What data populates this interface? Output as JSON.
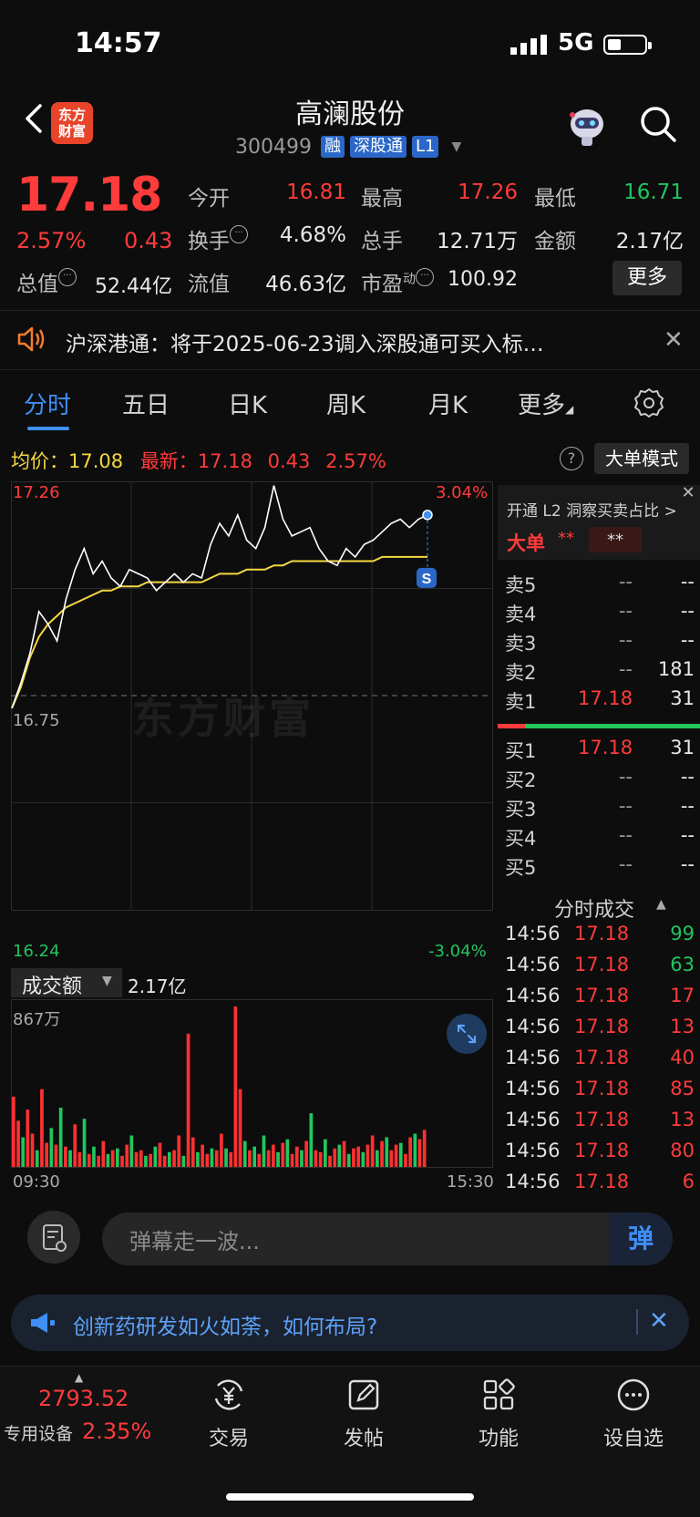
{
  "status": {
    "time": "14:57",
    "network": "5G"
  },
  "header": {
    "logo_line1": "东方",
    "logo_line2": "财富",
    "stock_name": "高澜股份",
    "stock_code": "300499",
    "tags": [
      "融",
      "深股通",
      "L1"
    ]
  },
  "quote": {
    "price": "17.18",
    "change_pct": "2.57%",
    "change_amt": "0.43",
    "market_cap_label": "总值",
    "market_cap": "52.44亿",
    "fields": [
      {
        "label": "今开",
        "value": "16.81",
        "color": "red"
      },
      {
        "label": "最高",
        "value": "17.26",
        "color": "red"
      },
      {
        "label": "最低",
        "value": "16.71",
        "color": "green"
      },
      {
        "label": "换手",
        "value": "4.68%",
        "color": "white"
      },
      {
        "label": "总手",
        "value": "12.71万",
        "color": "white"
      },
      {
        "label": "金额",
        "value": "2.17亿",
        "color": "white"
      },
      {
        "label": "流值",
        "value": "46.63亿",
        "color": "white"
      },
      {
        "label": "市盈",
        "value": "100.92",
        "color": "white",
        "superscript": "动"
      }
    ],
    "more_button": "更多"
  },
  "notice": {
    "text": "沪深港通：将于2025-06-23调入深股通可买入标…"
  },
  "tabs": [
    "分时",
    "五日",
    "日K",
    "周K",
    "月K",
    "更多"
  ],
  "avg_row": {
    "avg_label": "均价：",
    "avg_value": "17.08",
    "latest_label": "最新：",
    "latest_value": "17.18",
    "latest_chg": "0.43",
    "latest_pct": "2.57%",
    "mode_button": "大单模式"
  },
  "chart_data": {
    "type": "line",
    "y_ticks": {
      "high": "17.26",
      "mid": "16.75",
      "low": "16.24",
      "high_pct": "3.04%",
      "low_pct": "-3.04%"
    },
    "ylim": [
      16.24,
      17.26
    ],
    "x_labels": [
      "09:30",
      "15:30"
    ],
    "watermark": "东方财富",
    "series": [
      {
        "name": "price",
        "color": "#ffffff",
        "values": [
          16.72,
          16.78,
          16.85,
          16.95,
          16.92,
          16.88,
          16.98,
          17.05,
          17.1,
          17.04,
          17.07,
          17.03,
          17.01,
          17.05,
          17.04,
          17.03,
          17.0,
          17.02,
          17.04,
          17.02,
          17.04,
          17.03,
          17.11,
          17.16,
          17.13,
          17.18,
          17.12,
          17.1,
          17.15,
          17.25,
          17.17,
          17.13,
          17.14,
          17.15,
          17.1,
          17.07,
          17.06,
          17.1,
          17.08,
          17.11,
          17.12,
          17.14,
          17.16,
          17.17,
          17.15,
          17.17,
          17.18
        ]
      },
      {
        "name": "avg",
        "color": "#f5d742",
        "values": [
          16.72,
          16.77,
          16.84,
          16.89,
          16.92,
          16.94,
          16.96,
          16.97,
          16.98,
          16.99,
          17.0,
          17.0,
          17.01,
          17.01,
          17.01,
          17.02,
          17.02,
          17.02,
          17.02,
          17.02,
          17.02,
          17.02,
          17.03,
          17.04,
          17.04,
          17.04,
          17.05,
          17.05,
          17.05,
          17.06,
          17.06,
          17.07,
          17.07,
          17.07,
          17.07,
          17.07,
          17.07,
          17.07,
          17.07,
          17.07,
          17.07,
          17.08,
          17.08,
          17.08,
          17.08,
          17.08,
          17.08
        ]
      }
    ],
    "volume": {
      "label": "成交额",
      "total": "2.17亿",
      "max_label": "867万",
      "max": 867,
      "bars": [
        {
          "v": 380,
          "c": "r"
        },
        {
          "v": 250,
          "c": "r"
        },
        {
          "v": 160,
          "c": "g"
        },
        {
          "v": 310,
          "c": "r"
        },
        {
          "v": 180,
          "c": "r"
        },
        {
          "v": 90,
          "c": "g"
        },
        {
          "v": 420,
          "c": "r"
        },
        {
          "v": 130,
          "c": "r"
        },
        {
          "v": 210,
          "c": "g"
        },
        {
          "v": 120,
          "c": "r"
        },
        {
          "v": 320,
          "c": "g"
        },
        {
          "v": 110,
          "c": "r"
        },
        {
          "v": 90,
          "c": "g"
        },
        {
          "v": 230,
          "c": "r"
        },
        {
          "v": 80,
          "c": "r"
        },
        {
          "v": 260,
          "c": "g"
        },
        {
          "v": 70,
          "c": "r"
        },
        {
          "v": 110,
          "c": "g"
        },
        {
          "v": 60,
          "c": "r"
        },
        {
          "v": 140,
          "c": "r"
        },
        {
          "v": 70,
          "c": "g"
        },
        {
          "v": 90,
          "c": "r"
        },
        {
          "v": 100,
          "c": "g"
        },
        {
          "v": 60,
          "c": "r"
        },
        {
          "v": 120,
          "c": "r"
        },
        {
          "v": 170,
          "c": "g"
        },
        {
          "v": 80,
          "c": "r"
        },
        {
          "v": 90,
          "c": "r"
        },
        {
          "v": 60,
          "c": "g"
        },
        {
          "v": 70,
          "c": "r"
        },
        {
          "v": 110,
          "c": "g"
        },
        {
          "v": 130,
          "c": "r"
        },
        {
          "v": 60,
          "c": "r"
        },
        {
          "v": 80,
          "c": "g"
        },
        {
          "v": 90,
          "c": "r"
        },
        {
          "v": 170,
          "c": "r"
        },
        {
          "v": 60,
          "c": "g"
        },
        {
          "v": 720,
          "c": "r"
        },
        {
          "v": 160,
          "c": "r"
        },
        {
          "v": 80,
          "c": "g"
        },
        {
          "v": 120,
          "c": "r"
        },
        {
          "v": 70,
          "c": "r"
        },
        {
          "v": 100,
          "c": "g"
        },
        {
          "v": 90,
          "c": "r"
        },
        {
          "v": 180,
          "c": "r"
        },
        {
          "v": 100,
          "c": "g"
        },
        {
          "v": 80,
          "c": "r"
        },
        {
          "v": 867,
          "c": "r"
        },
        {
          "v": 420,
          "c": "r"
        },
        {
          "v": 140,
          "c": "g"
        },
        {
          "v": 90,
          "c": "r"
        },
        {
          "v": 110,
          "c": "g"
        },
        {
          "v": 70,
          "c": "r"
        },
        {
          "v": 170,
          "c": "g"
        },
        {
          "v": 90,
          "c": "r"
        },
        {
          "v": 120,
          "c": "r"
        },
        {
          "v": 80,
          "c": "g"
        },
        {
          "v": 130,
          "c": "r"
        },
        {
          "v": 150,
          "c": "g"
        },
        {
          "v": 70,
          "c": "r"
        },
        {
          "v": 110,
          "c": "r"
        },
        {
          "v": 90,
          "c": "g"
        },
        {
          "v": 140,
          "c": "r"
        },
        {
          "v": 290,
          "c": "g"
        },
        {
          "v": 90,
          "c": "r"
        },
        {
          "v": 80,
          "c": "r"
        },
        {
          "v": 150,
          "c": "g"
        },
        {
          "v": 60,
          "c": "r"
        },
        {
          "v": 100,
          "c": "r"
        },
        {
          "v": 120,
          "c": "g"
        },
        {
          "v": 140,
          "c": "r"
        },
        {
          "v": 70,
          "c": "g"
        },
        {
          "v": 100,
          "c": "r"
        },
        {
          "v": 110,
          "c": "r"
        },
        {
          "v": 80,
          "c": "g"
        },
        {
          "v": 120,
          "c": "r"
        },
        {
          "v": 170,
          "c": "r"
        },
        {
          "v": 90,
          "c": "g"
        },
        {
          "v": 140,
          "c": "r"
        },
        {
          "v": 160,
          "c": "g"
        },
        {
          "v": 90,
          "c": "r"
        },
        {
          "v": 120,
          "c": "r"
        },
        {
          "v": 130,
          "c": "g"
        },
        {
          "v": 70,
          "c": "r"
        },
        {
          "v": 160,
          "c": "r"
        },
        {
          "v": 180,
          "c": "g"
        },
        {
          "v": 150,
          "c": "r"
        },
        {
          "v": 200,
          "c": "r"
        }
      ]
    }
  },
  "order_book": {
    "l2_tip": "开通 L2 洞察买卖占比 >",
    "big_order_label": "大单",
    "big_order_val": "**",
    "big_order_val2": "**",
    "sells": [
      {
        "label": "卖5",
        "price": "--",
        "qty": "--"
      },
      {
        "label": "卖4",
        "price": "--",
        "qty": "--"
      },
      {
        "label": "卖3",
        "price": "--",
        "qty": "--"
      },
      {
        "label": "卖2",
        "price": "--",
        "qty": "181"
      },
      {
        "label": "卖1",
        "price": "17.18",
        "qty": "31"
      }
    ],
    "buys": [
      {
        "label": "买1",
        "price": "17.18",
        "qty": "31"
      },
      {
        "label": "买2",
        "price": "--",
        "qty": "--"
      },
      {
        "label": "买3",
        "price": "--",
        "qty": "--"
      },
      {
        "label": "买4",
        "price": "--",
        "qty": "--"
      },
      {
        "label": "买5",
        "price": "--",
        "qty": "--"
      }
    ],
    "ticks_title": "分时成交",
    "ticks": [
      {
        "time": "14:56",
        "price": "17.18",
        "vol": "99",
        "dir": "g"
      },
      {
        "time": "14:56",
        "price": "17.18",
        "vol": "63",
        "dir": "g"
      },
      {
        "time": "14:56",
        "price": "17.18",
        "vol": "17",
        "dir": "r"
      },
      {
        "time": "14:56",
        "price": "17.18",
        "vol": "13",
        "dir": "r"
      },
      {
        "time": "14:56",
        "price": "17.18",
        "vol": "40",
        "dir": "r"
      },
      {
        "time": "14:56",
        "price": "17.18",
        "vol": "85",
        "dir": "r"
      },
      {
        "time": "14:56",
        "price": "17.18",
        "vol": "13",
        "dir": "r"
      },
      {
        "time": "14:56",
        "price": "17.18",
        "vol": "80",
        "dir": "r"
      },
      {
        "time": "14:56",
        "price": "17.18",
        "vol": "6",
        "dir": "r"
      }
    ]
  },
  "danmaku": {
    "placeholder": "弹幕走一波...",
    "button": "弹"
  },
  "promo": {
    "text": "创新药研发如火如荼，如何布局?"
  },
  "bottom_nav": {
    "index_value": "2793.52",
    "index_label": "专用设备",
    "index_pct": "2.35%",
    "items": [
      {
        "label": "交易",
        "icon": "yen-exchange-icon"
      },
      {
        "label": "发帖",
        "icon": "edit-icon"
      },
      {
        "label": "功能",
        "icon": "apps-grid-icon"
      },
      {
        "label": "设自选",
        "icon": "more-dots-icon"
      }
    ]
  }
}
